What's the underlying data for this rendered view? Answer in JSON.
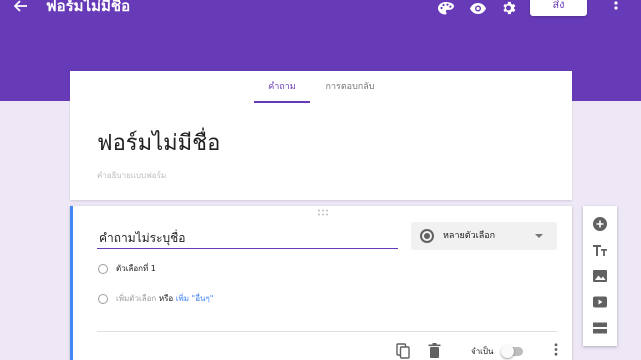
{
  "header": {
    "title": "ฟอร์มไม่มีชื่อ",
    "send_label": "ส่ง",
    "icons": [
      "arrow-back-icon",
      "palette-icon",
      "eye-icon",
      "gear-icon",
      "more-vert-icon"
    ],
    "brand_color": "#673ab7"
  },
  "tabs": [
    {
      "label": "คำถาม",
      "active": true
    },
    {
      "label": "การตอบกลับ",
      "active": false
    }
  ],
  "form": {
    "title": "ฟอร์มไม่มีชื่อ",
    "description_placeholder": "คำอธิบายแบบฟอร์ม"
  },
  "question": {
    "title": "คำถามไม่ระบุชื่อ",
    "type_label": "หลายตัวเลือก",
    "options": [
      {
        "label": "ตัวเลือกที่ 1"
      }
    ],
    "add_option": {
      "label": "เพิ่มตัวเลือก",
      "or": "หรือ",
      "add_other": "เพิ่ม \"อื่นๆ\""
    },
    "required_label": "จำเป็น",
    "required_on": false,
    "accent_color": "#4285f4"
  },
  "side_toolbar": {
    "tools": [
      "add-question-icon",
      "title-text-icon",
      "image-icon",
      "video-icon",
      "section-icon"
    ]
  }
}
